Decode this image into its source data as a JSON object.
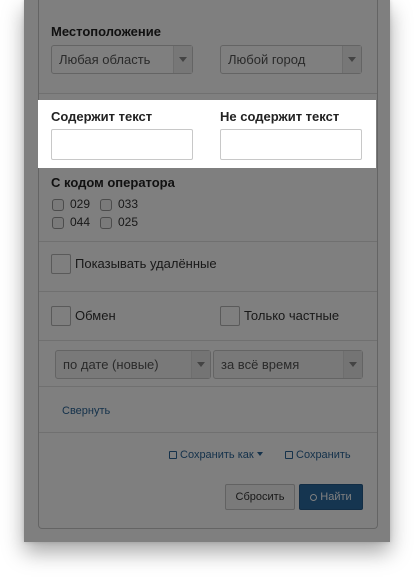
{
  "location": {
    "heading": "Местоположение",
    "region_select": "Любая область",
    "city_select": "Любой город"
  },
  "text_filters": {
    "contains_label": "Содержит текст",
    "not_contains_label": "Не содержит текст",
    "contains_value": "",
    "not_contains_value": ""
  },
  "operator": {
    "heading": "С кодом оператора",
    "codes": [
      "029",
      "033",
      "044",
      "025"
    ]
  },
  "options": {
    "show_deleted": "Показывать удалённые",
    "exchange": "Обмен",
    "private_only": "Только частные"
  },
  "sort": {
    "order_select": "по дате (новые)",
    "period_select": "за всё время"
  },
  "collapse_link": "Свернуть",
  "save": {
    "save_as": "Сохранить как",
    "save": "Сохранить"
  },
  "buttons": {
    "reset": "Сбросить",
    "search": "Найти"
  },
  "colors": {
    "primary": "#2a6aa1",
    "link": "#2a6496",
    "overlay": "rgba(0,0,0,0.5)"
  }
}
